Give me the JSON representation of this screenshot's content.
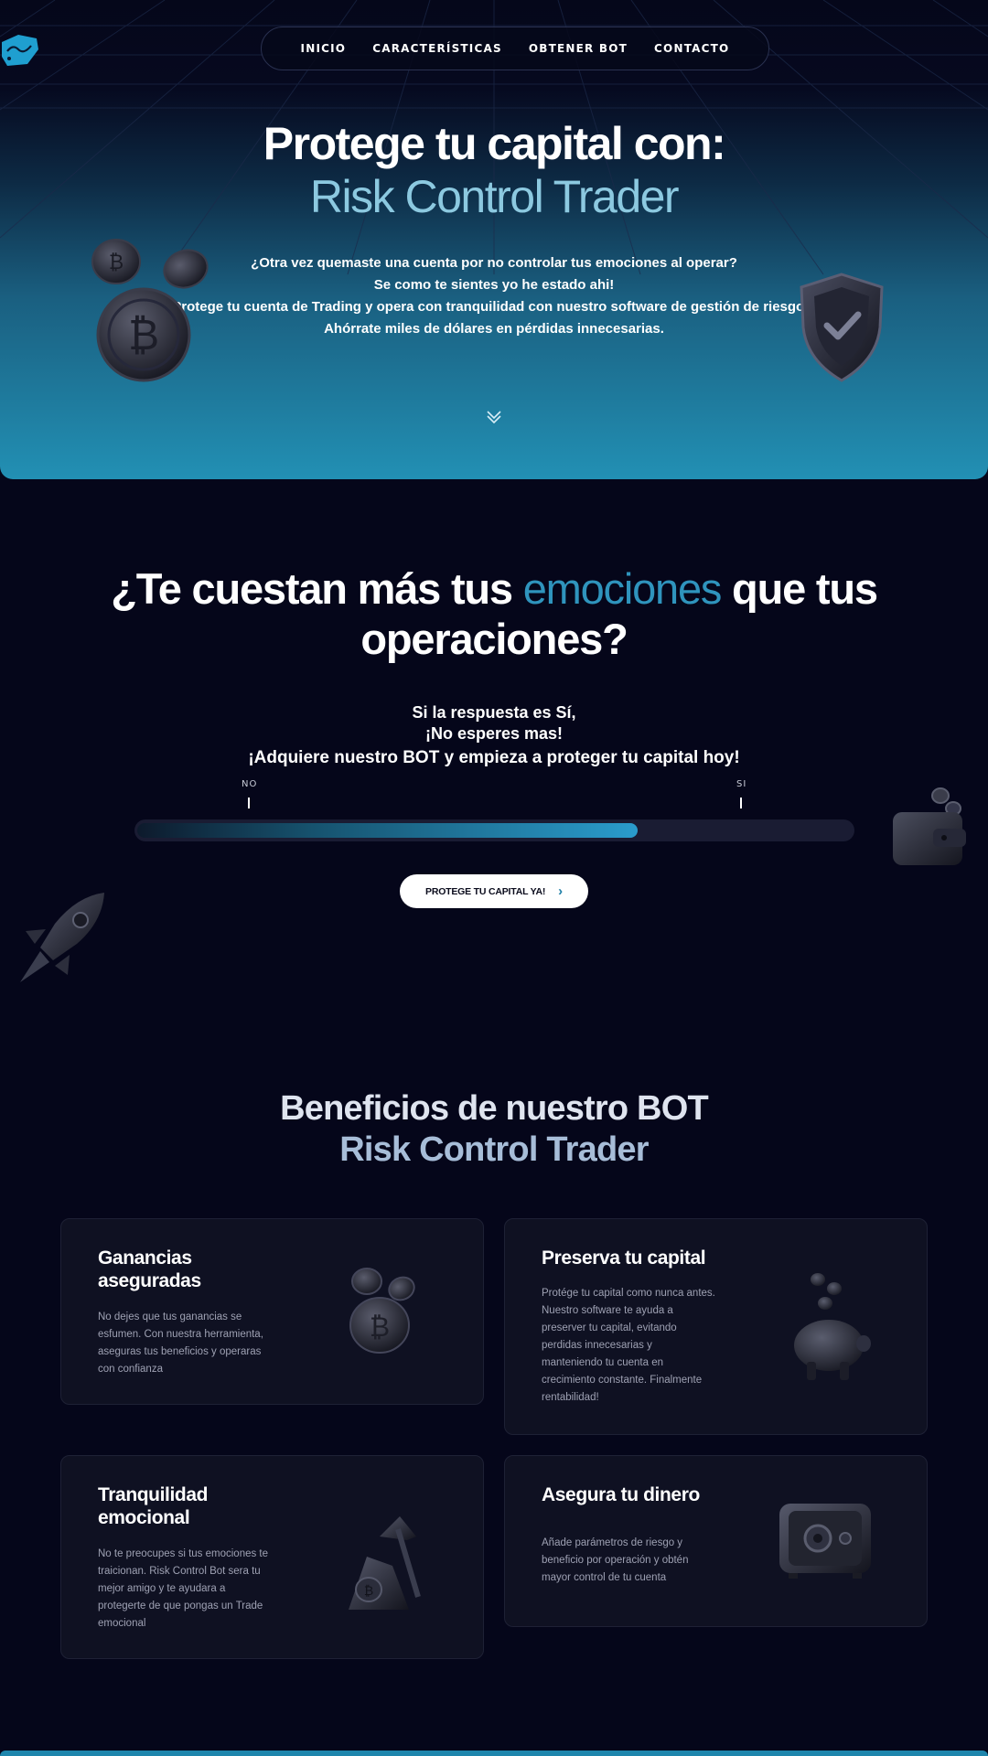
{
  "nav": {
    "items": [
      "INICIO",
      "CARACTERÍSTICAS",
      "OBTENER BOT",
      "CONTACTO"
    ]
  },
  "hero": {
    "title_line1": "Protege tu capital con:",
    "title_line2": "Risk Control Trader",
    "text_lines": [
      "¿Otra vez quemaste una cuenta por no controlar tus emociones al operar?",
      "Se como te sientes yo he estado ahi!",
      "Protege tu cuenta de Trading y opera con tranquilidad con nuestro software de gestión de riesgos.",
      "Ahórrate miles de dólares en pérdidas innecesarias."
    ]
  },
  "question": {
    "title_part1": "¿Te cuestan más tus ",
    "title_accent": "emociones",
    "title_part2": " que tus",
    "title_line2": "operaciones?",
    "sub_line1": "Si la respuesta es Sí,",
    "sub_line2": "¡No esperes mas!",
    "cta_text": "¡Adquiere nuestro BOT y empieza a proteger tu capital hoy!",
    "scale_left": "NO",
    "scale_right": "SI",
    "progress_fraction": 0.7,
    "button_label": "PROTEGE TU CAPITAL YA!"
  },
  "benefits": {
    "title_line1": "Beneficios de nuestro BOT",
    "title_line2": "Risk Control Trader",
    "cards": [
      {
        "title": "Ganancias aseguradas",
        "text": "No dejes que tus ganancias se esfumen. Con nuestra herramienta, aseguras tus beneficios y operaras con confianza"
      },
      {
        "title": "Preserva tu capital",
        "text": "Protége tu capital como nunca antes. Nuestro software te ayuda a preserver tu capital, evitando perdidas innecesarias y manteniendo tu cuenta en crecimiento constante. Finalmente rentabilidad!"
      },
      {
        "title": "Tranquilidad emocional",
        "text": "No te preocupes si tus emociones te traicionan. Risk Control Bot sera tu mejor amigo y te ayudara a protegerte de que pongas un Trade emocional"
      },
      {
        "title": "Asegura tu dinero",
        "text": "Añade parámetros de riesgo y beneficio por operación y obtén mayor control de tu cuenta"
      }
    ]
  },
  "colors": {
    "background": "#05061a",
    "accent": "#2f94bd",
    "hero_bottom": "#2290b4",
    "card_bg": "#0f1122"
  },
  "icons": [
    "logo-icon",
    "coins-icon",
    "shield-check-icon",
    "chevron-down-icon",
    "wallet-icon",
    "rocket-icon",
    "coin-stack-icon",
    "piggy-bank-icon",
    "pickaxe-coin-icon",
    "safe-icon",
    "chevron-right-icon"
  ]
}
